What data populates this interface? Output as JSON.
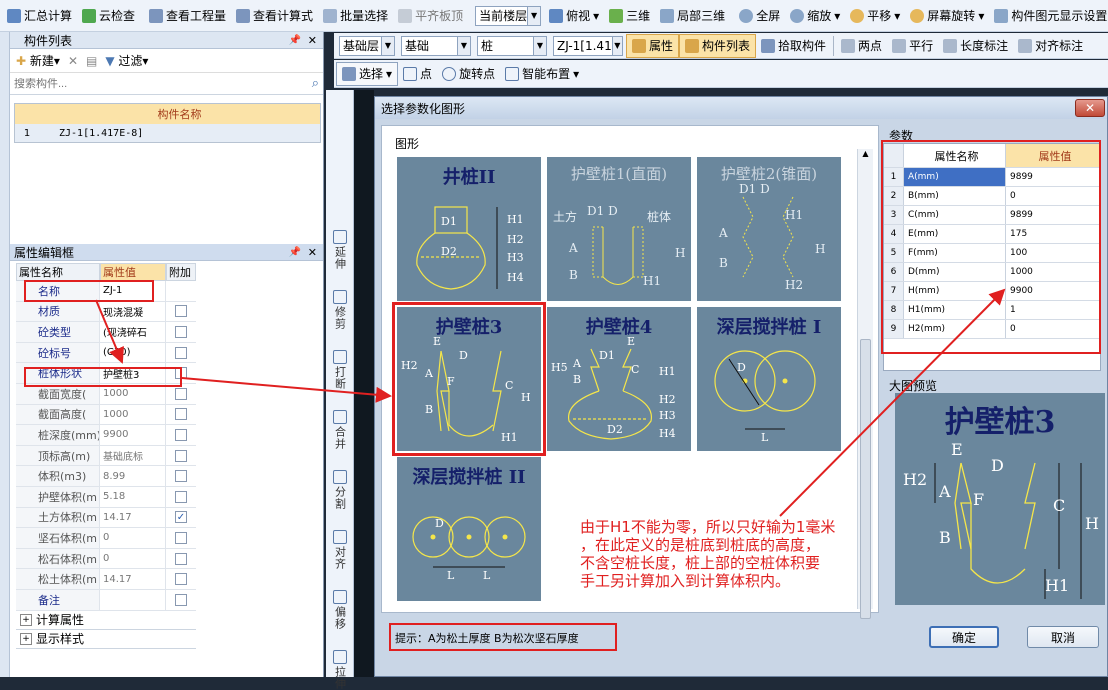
{
  "toolbar1": {
    "items": [
      "汇总计算",
      "云检查",
      "查看工程量",
      "查看计算式",
      "批量选择",
      "平齐板顶"
    ],
    "floor_combo": "当前楼层",
    "view_items": [
      "俯视",
      "三维",
      "局部三维",
      "全屏",
      "缩放",
      "平移",
      "屏幕旋转",
      "构件图元显示设置"
    ]
  },
  "toolbar2": {
    "layer": "基础层",
    "cat": "基础",
    "type": "桩",
    "comp": "ZJ-1[1.41",
    "buttons": [
      "属性",
      "构件列表",
      "拾取构件",
      "两点",
      "平行",
      "长度标注",
      "对齐标注"
    ]
  },
  "toolbar3": {
    "buttons": [
      "选择",
      "点",
      "旋转点",
      "智能布置"
    ]
  },
  "component_list": {
    "title": "构件列表",
    "new_label": "新建",
    "filter_label": "过滤",
    "search_placeholder": "搜索构件...",
    "col_header": "构件名称",
    "rows": [
      {
        "no": "1",
        "name": "ZJ-1[1.417E-8]"
      }
    ]
  },
  "property_editor": {
    "title": "属性编辑框",
    "headers": [
      "属性名称",
      "属性值",
      "附加"
    ],
    "rows": [
      {
        "name": "名称",
        "value": "ZJ-1",
        "check": "",
        "blue": true
      },
      {
        "name": "材质",
        "value": "现浇混凝",
        "check": "n",
        "blue": true
      },
      {
        "name": "砼类型",
        "value": "(现浇碎石",
        "check": "n",
        "blue": true
      },
      {
        "name": "砼标号",
        "value": "(C30)",
        "check": "n",
        "blue": true
      },
      {
        "name": "桩体形状",
        "value": "护壁桩3",
        "check": "n",
        "blue": true
      },
      {
        "name": "截面宽度(",
        "value": "1000",
        "check": "n",
        "blue": false
      },
      {
        "name": "截面高度(",
        "value": "1000",
        "check": "n",
        "blue": false
      },
      {
        "name": "桩深度(mm)",
        "value": "9900",
        "check": "n",
        "blue": false
      },
      {
        "name": "顶标高(m)",
        "value": "基础底标",
        "check": "n",
        "blue": false
      },
      {
        "name": "体积(m3)",
        "value": "8.99",
        "check": "n",
        "blue": false
      },
      {
        "name": "护壁体积(m",
        "value": "5.18",
        "check": "n",
        "blue": false
      },
      {
        "name": "土方体积(m",
        "value": "14.17",
        "check": "y",
        "blue": false
      },
      {
        "name": "坚石体积(m",
        "value": "0",
        "check": "n",
        "blue": false
      },
      {
        "name": "松石体积(m",
        "value": "0",
        "check": "n",
        "blue": false
      },
      {
        "name": "松土体积(m",
        "value": "14.17",
        "check": "n",
        "blue": false
      },
      {
        "name": "备注",
        "value": "",
        "check": "n",
        "blue": true
      }
    ],
    "groups": [
      "计算属性",
      "显示样式"
    ]
  },
  "vtools": [
    "延伸",
    "修剪",
    "打断",
    "合并",
    "分割",
    "对齐",
    "偏移",
    "拉伸"
  ],
  "dialog": {
    "title": "选择参数化图形",
    "shape_group": "图形",
    "tiles": [
      "井桩II",
      "护壁桩1(直面)",
      "护壁桩2(锥面)",
      "护壁桩3",
      "护壁桩4",
      "深层搅拌桩 I",
      "深层搅拌桩 II"
    ],
    "params_label": "参数",
    "param_headers": [
      "属性名称",
      "属性值"
    ],
    "params": [
      {
        "no": "1",
        "name": "A(mm)",
        "value": "9899"
      },
      {
        "no": "2",
        "name": "B(mm)",
        "value": "0"
      },
      {
        "no": "3",
        "name": "C(mm)",
        "value": "9899"
      },
      {
        "no": "4",
        "name": "E(mm)",
        "value": "175"
      },
      {
        "no": "5",
        "name": "F(mm)",
        "value": "100"
      },
      {
        "no": "6",
        "name": "D(mm)",
        "value": "1000"
      },
      {
        "no": "7",
        "name": "H(mm)",
        "value": "9900"
      },
      {
        "no": "8",
        "name": "H1(mm)",
        "value": "1"
      },
      {
        "no": "9",
        "name": "H2(mm)",
        "value": "0"
      }
    ],
    "preview_label": "大图预览",
    "preview_title": "护壁桩3",
    "hint": "提示：A为松土厚度  B为松次坚石厚度",
    "ok": "确定",
    "cancel": "取消"
  },
  "annotation": {
    "lines": [
      "由于H1不能为零，所以只好输为1毫米",
      "，在此定义的是桩底到桩底的高度，",
      "不含空桩长度，桩上部的空桩体积要",
      "手工另计算加入到计算体积内。"
    ]
  },
  "colors": {
    "accent": "#e02020",
    "tile": "#6a879d",
    "header": "#f7c96a"
  }
}
